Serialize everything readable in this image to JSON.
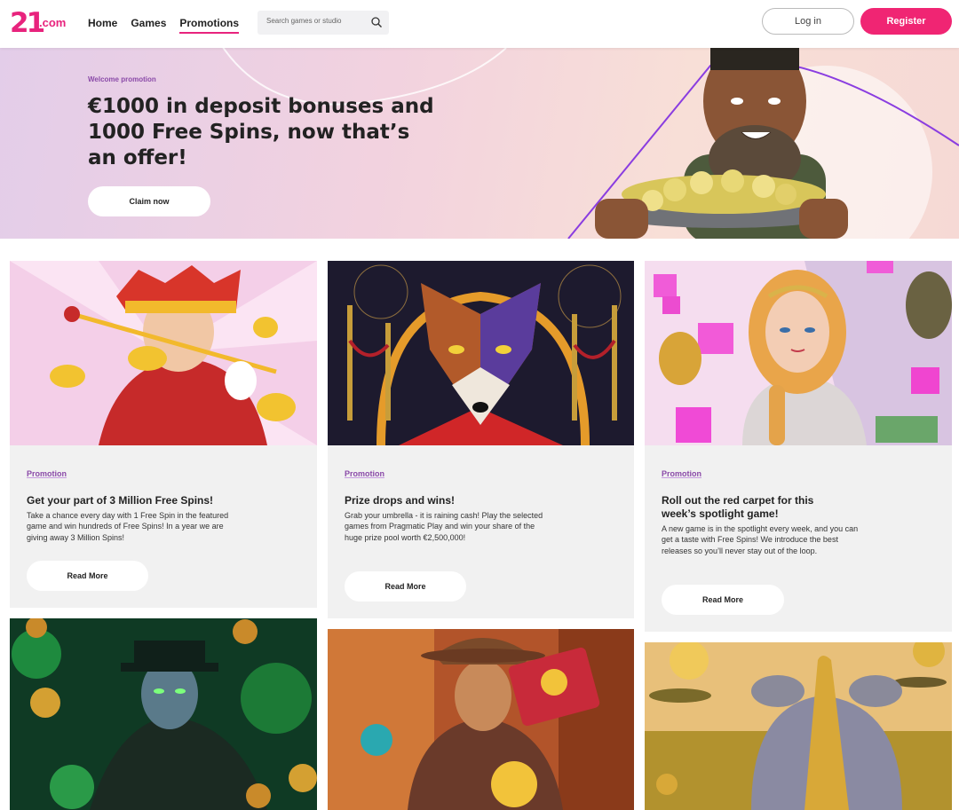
{
  "header": {
    "logo_main": "21",
    "logo_suffix": ".com",
    "nav": [
      {
        "label": "Home"
      },
      {
        "label": "Games"
      },
      {
        "label": "Promotions"
      }
    ],
    "search_placeholder": "Search games or studio",
    "login_label": "Log in",
    "register_label": "Register"
  },
  "hero": {
    "tag": "Welcome promotion",
    "title": "€1000 in deposit bonuses and 1000 Free Spins, now that’s an offer!",
    "button": "Claim now"
  },
  "cards": [
    {
      "tag": "Promotion",
      "title": "Get your part of 3 Million Free Spins!",
      "description": "Take a chance every day with 1 Free Spin in the featured game and win hundreds of Free Spins! In a year we are giving away 3 Million Spins!",
      "button": "Read More"
    },
    {
      "tag": "Promotion",
      "title": "Prize drops and wins!",
      "description": "Grab your umbrella - it is raining cash! Play the selected games from Pragmatic Play and win your share of the huge prize pool worth €2,500,000!",
      "button": "Read More"
    },
    {
      "tag": "Promotion",
      "title": "Roll out the red carpet for this week’s spotlight game!",
      "description": "A new game is in the spotlight every week, and you can get a taste with Free Spins! We introduce the best releases so you’ll never stay out of the loop.",
      "button": "Read More"
    }
  ],
  "colors": {
    "brand_pink": "#f02573",
    "accent_purple": "#8a4aa8"
  }
}
